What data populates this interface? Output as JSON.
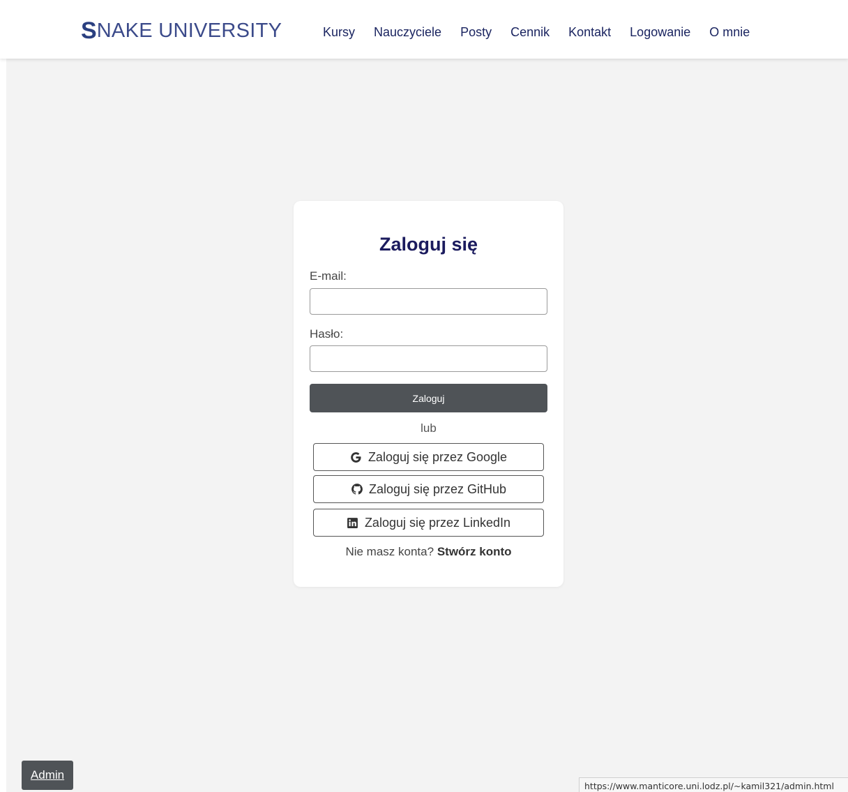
{
  "brand": {
    "logo_letter": "S",
    "logo_rest": "NAKE UNIVERSITY"
  },
  "nav": {
    "items": [
      {
        "label": "Kursy"
      },
      {
        "label": "Nauczyciele"
      },
      {
        "label": "Posty"
      },
      {
        "label": "Cennik"
      },
      {
        "label": "Kontakt"
      },
      {
        "label": "Logowanie"
      },
      {
        "label": "O mnie"
      }
    ]
  },
  "login": {
    "title": "Zaloguj się",
    "email_label": "E-mail:",
    "email_value": "",
    "password_label": "Hasło:",
    "password_value": "",
    "submit_label": "Zaloguj",
    "or_text": "lub",
    "google_label": "Zaloguj się przez Google",
    "github_label": "Zaloguj się przez GitHub",
    "linkedin_label": "Zaloguj się przez LinkedIn",
    "signup_prompt": "Nie masz konta?",
    "signup_link": "Stwórz konto"
  },
  "admin": {
    "label": "Admin"
  },
  "status_bar": {
    "url": "https://www.manticore.uni.lodz.pl/~kamil321/admin.html"
  },
  "colors": {
    "brand": "#2a3f80",
    "nav_text": "#1a2460",
    "title": "#1b1b5e",
    "button_dark": "#4f5357",
    "background": "#f3f3f3"
  },
  "icons": {
    "google": "google-icon",
    "github": "github-icon",
    "linkedin": "linkedin-icon"
  }
}
